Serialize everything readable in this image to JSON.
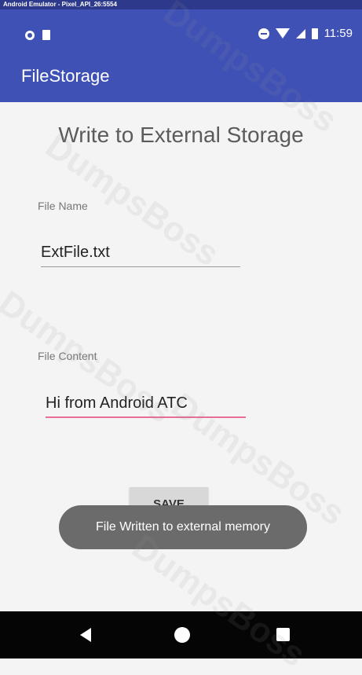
{
  "emulator": {
    "title": "Android Emulator - Pixel_API_26:5554"
  },
  "status_bar": {
    "time": "11:59"
  },
  "app_bar": {
    "title": "FileStorage"
  },
  "main": {
    "heading": "Write to External Storage",
    "file_name": {
      "label": "File Name",
      "value": "ExtFile.txt"
    },
    "file_content": {
      "label": "File Content",
      "value": "Hi from Android ATC"
    },
    "save_label": "SAVE"
  },
  "toast": {
    "message": "File Written to external memory"
  },
  "watermark": "DumpsBoss",
  "colors": {
    "primary": "#3f51b5",
    "accent_underline": "#e86e9a",
    "toast_bg": "#6b6b6b",
    "nav_bg": "#050505"
  }
}
